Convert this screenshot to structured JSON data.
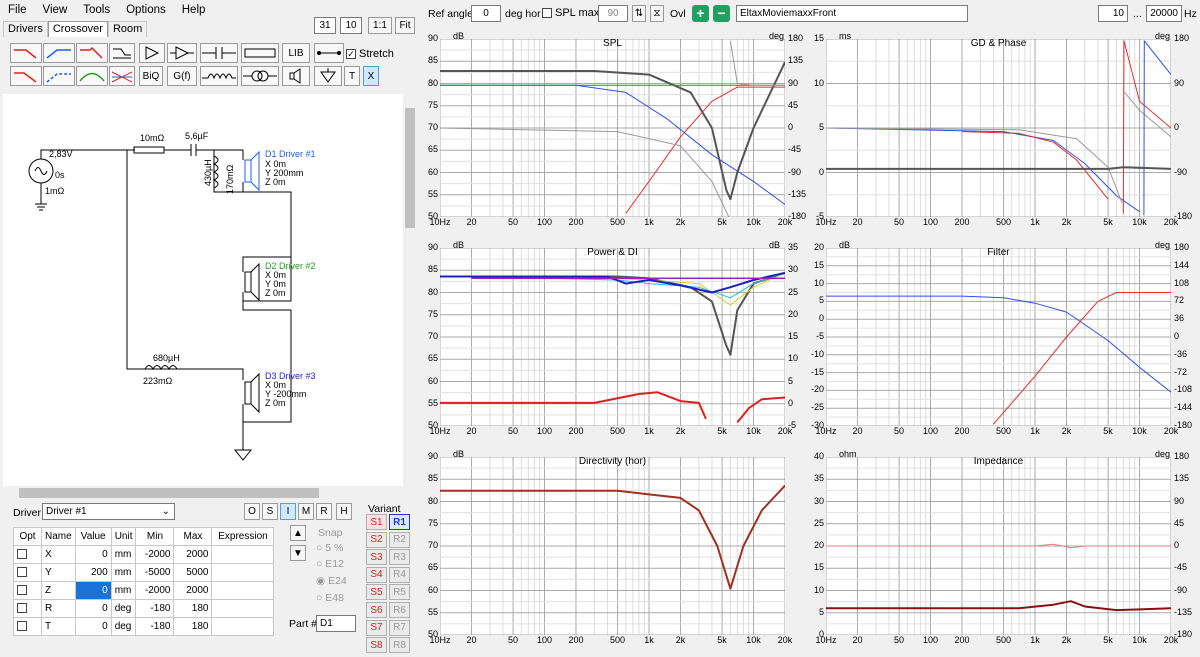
{
  "menu": {
    "file": "File",
    "view": "View",
    "tools": "Tools",
    "options": "Options",
    "help": "Help"
  },
  "tabs": {
    "drivers": "Drivers",
    "crossover": "Crossover",
    "room": "Room"
  },
  "zoom": {
    "v1": "31",
    "v2": "10",
    "ratio": "1:1",
    "fit": "Fit"
  },
  "toolbar": {
    "lib": "LIB",
    "stretch": "Stretch",
    "biq": "BiQ",
    "gf": "G(f)",
    "t": "T",
    "x": "X"
  },
  "top": {
    "ref_angle_label": "Ref angle",
    "ref_angle": "0",
    "deg_hor": "deg hor",
    "spl_max_label": "SPL max",
    "spl_max": "90",
    "ovl": "Ovl",
    "project": "EltaxMoviemaxxFront",
    "f_min": "10",
    "dots": "...",
    "f_max": "20000",
    "hz": "Hz"
  },
  "schematic": {
    "source_v": "2,83V",
    "source_deg": "0s",
    "source_r": "1mΩ",
    "r1": "10mΩ",
    "c1": "5,6µF",
    "l1": "430µH",
    "l1r": "170mΩ",
    "l2": "680µH",
    "l2r": "223mΩ",
    "d1_name": "D1 Driver #1",
    "d1_x": "X 0m",
    "d1_y": "Y 200mm",
    "d1_z": "Z 0m",
    "d2_name": "D2 Driver #2",
    "d2_x": "X 0m",
    "d2_y": "Y 0m",
    "d2_z": "Z 0m",
    "d3_name": "D3 Driver #3",
    "d3_x": "X 0m",
    "d3_y": "Y -200mm",
    "d3_z": "Z 0m"
  },
  "driver_panel": {
    "label": "Driver",
    "selected": "Driver #1",
    "modes": [
      "O",
      "S",
      "I",
      "M",
      "R",
      "H"
    ],
    "variant_label": "Variant",
    "snap": "Snap",
    "snap_opts": [
      "5 %",
      "E12",
      "E24",
      "E48"
    ],
    "part_label": "Part #",
    "part": "D1"
  },
  "params": {
    "headers": [
      "Opt",
      "Name",
      "Value",
      "Unit",
      "Min",
      "Max",
      "Expression"
    ],
    "rows": [
      [
        "X",
        "0",
        "mm",
        "-2000",
        "2000"
      ],
      [
        "Y",
        "200",
        "mm",
        "-5000",
        "5000"
      ],
      [
        "Z",
        "0",
        "mm",
        "-2000",
        "2000"
      ],
      [
        "R",
        "0",
        "deg",
        "-180",
        "180"
      ],
      [
        "T",
        "0",
        "deg",
        "-180",
        "180"
      ]
    ]
  },
  "variants": {
    "s": [
      "S1",
      "S2",
      "S3",
      "S4",
      "S5",
      "S6",
      "S7",
      "S8"
    ],
    "r": [
      "R1",
      "R2",
      "R3",
      "R4",
      "R5",
      "R6",
      "R7",
      "R8"
    ]
  },
  "graphs": {
    "spl": {
      "title": "SPL",
      "left_unit": "dB",
      "right_unit": "deg",
      "left": [
        "90",
        "85",
        "80",
        "75",
        "70",
        "65",
        "60",
        "55",
        "50"
      ],
      "right": [
        "180",
        "135",
        "90",
        "45",
        "0",
        "-45",
        "-90",
        "-135",
        "-180"
      ]
    },
    "gd": {
      "title": "GD & Phase",
      "left_unit": "ms",
      "right_unit": "deg",
      "left": [
        "15",
        "10",
        "5",
        "0",
        "-5"
      ],
      "right": [
        "180",
        "90",
        "0",
        "-90",
        "-180"
      ]
    },
    "power": {
      "title": "Power & DI",
      "left_unit": "dB",
      "right_unit": "dB",
      "left": [
        "90",
        "85",
        "80",
        "75",
        "70",
        "65",
        "60",
        "55",
        "50"
      ],
      "right": [
        "35",
        "30",
        "25",
        "20",
        "15",
        "10",
        "5",
        "0",
        "-5"
      ]
    },
    "filter": {
      "title": "Filter",
      "left_unit": "dB",
      "right_unit": "deg",
      "left": [
        "20",
        "15",
        "10",
        "5",
        "0",
        "-5",
        "-10",
        "-15",
        "-20",
        "-25",
        "-30"
      ],
      "right": [
        "180",
        "144",
        "108",
        "72",
        "36",
        "0",
        "-36",
        "-72",
        "-108",
        "-144",
        "-180"
      ]
    },
    "dir": {
      "title": "Directivity (hor)",
      "left_unit": "dB",
      "right_unit": "",
      "left": [
        "90",
        "85",
        "80",
        "75",
        "70",
        "65",
        "60",
        "55",
        "50"
      ],
      "right": []
    },
    "imp": {
      "title": "Impedance",
      "left_unit": "ohm",
      "right_unit": "deg",
      "left": [
        "40",
        "35",
        "30",
        "25",
        "20",
        "15",
        "10",
        "5",
        "0"
      ],
      "right": [
        "180",
        "135",
        "90",
        "45",
        "0",
        "-45",
        "-90",
        "-135",
        "-180"
      ]
    },
    "xticks": [
      "10Hz",
      "20",
      "50",
      "100",
      "200",
      "500",
      "1k",
      "2k",
      "5k",
      "10k",
      "20k"
    ]
  }
}
